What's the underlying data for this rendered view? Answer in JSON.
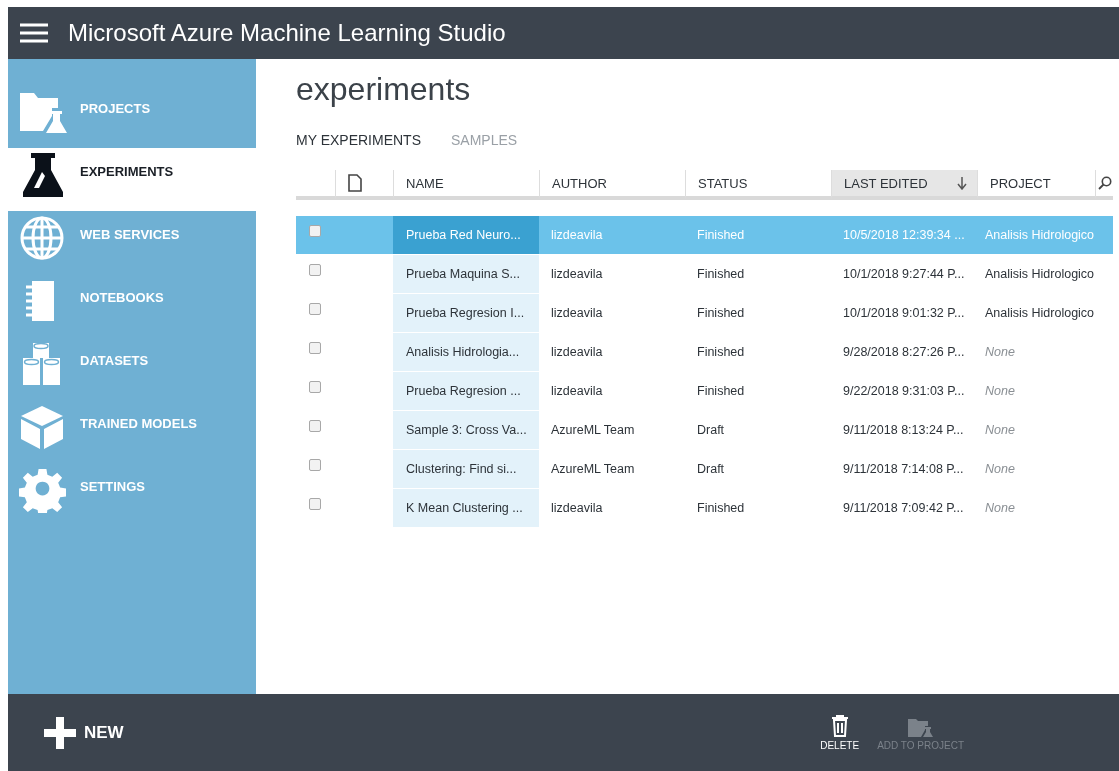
{
  "window": {
    "title": "Microsoft Azure Machine Learning Studio"
  },
  "sidebar": {
    "items": [
      {
        "label": "PROJECTS",
        "kind": "projects",
        "selected": false
      },
      {
        "label": "EXPERIMENTS",
        "kind": "experiments",
        "selected": true
      },
      {
        "label": "WEB SERVICES",
        "kind": "web",
        "selected": false
      },
      {
        "label": "NOTEBOOKS",
        "kind": "notebooks",
        "selected": false
      },
      {
        "label": "DATASETS",
        "kind": "datasets",
        "selected": false
      },
      {
        "label": "TRAINED MODELS",
        "kind": "models",
        "selected": false
      },
      {
        "label": "SETTINGS",
        "kind": "settings",
        "selected": false
      }
    ]
  },
  "page_title": "experiments",
  "tabs": [
    {
      "label": "MY EXPERIMENTS",
      "selected": true
    },
    {
      "label": "SAMPLES",
      "selected": false
    }
  ],
  "table": {
    "columns": [
      {
        "label": "NAME",
        "sorted": false
      },
      {
        "label": "AUTHOR",
        "sorted": false
      },
      {
        "label": "STATUS",
        "sorted": false
      },
      {
        "label": "LAST EDITED",
        "sorted": true
      },
      {
        "label": "PROJECT",
        "sorted": false
      }
    ],
    "rows": [
      {
        "name": "Prueba Red Neuro...",
        "author": "lizdeavila",
        "status": "Finished",
        "last_edited": "10/5/2018 12:39:34 ...",
        "project": "Analisis Hidrologico",
        "project_placeholder": false,
        "selected": true,
        "checked": false
      },
      {
        "name": "Prueba Maquina S...",
        "author": "lizdeavila",
        "status": "Finished",
        "last_edited": "10/1/2018 9:27:44 P...",
        "project": "Analisis Hidrologico",
        "project_placeholder": false,
        "selected": false,
        "checked": false
      },
      {
        "name": "Prueba Regresion I...",
        "author": "lizdeavila",
        "status": "Finished",
        "last_edited": "10/1/2018 9:01:32 P...",
        "project": "Analisis Hidrologico",
        "project_placeholder": false,
        "selected": false,
        "checked": false
      },
      {
        "name": "Analisis Hidrologia...",
        "author": "lizdeavila",
        "status": "Finished",
        "last_edited": "9/28/2018 8:27:26 P...",
        "project": "None",
        "project_placeholder": true,
        "selected": false,
        "checked": false
      },
      {
        "name": "Prueba Regresion ...",
        "author": "lizdeavila",
        "status": "Finished",
        "last_edited": "9/22/2018 9:31:03 P...",
        "project": "None",
        "project_placeholder": true,
        "selected": false,
        "checked": false
      },
      {
        "name": "Sample 3: Cross Va...",
        "author": "AzureML Team",
        "status": "Draft",
        "last_edited": "9/11/2018 8:13:24 P...",
        "project": "None",
        "project_placeholder": true,
        "selected": false,
        "checked": false
      },
      {
        "name": "Clustering: Find si...",
        "author": "AzureML Team",
        "status": "Draft",
        "last_edited": "9/11/2018 7:14:08 P...",
        "project": "None",
        "project_placeholder": true,
        "selected": false,
        "checked": false
      },
      {
        "name": "K Mean Clustering ...",
        "author": "lizdeavila",
        "status": "Finished",
        "last_edited": "9/11/2018 7:09:42 P...",
        "project": "None",
        "project_placeholder": true,
        "selected": false,
        "checked": false
      }
    ]
  },
  "bottom_bar": {
    "new_label": "NEW",
    "actions": [
      {
        "label": "DELETE",
        "kind": "delete",
        "disabled": false
      },
      {
        "label": "ADD TO PROJECT",
        "kind": "add",
        "disabled": true
      }
    ]
  }
}
